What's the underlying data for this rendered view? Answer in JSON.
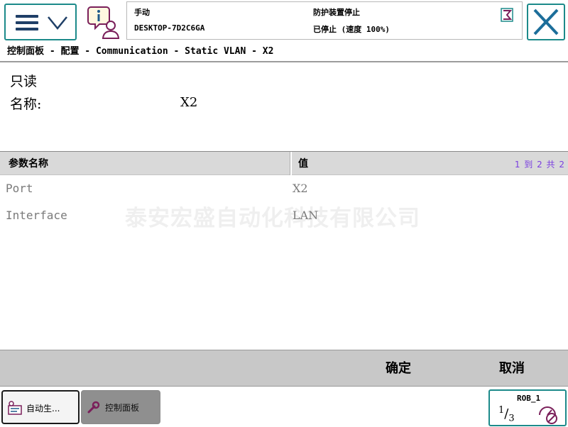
{
  "status": {
    "mode": "手动",
    "host": "DESKTOP-7D2C6GA",
    "guard": "防护装置停止",
    "speed": "已停止 (速度 100%)"
  },
  "breadcrumb": "控制面板 - 配置 - Communication - Static VLAN - X2",
  "info": {
    "readonly": "只读",
    "name_label": "名称:",
    "name_value": "X2"
  },
  "table": {
    "col_name": "参数名称",
    "col_value": "值",
    "pager": "1 到 2 共 2",
    "rows": [
      {
        "name": "Port",
        "value": "X2"
      },
      {
        "name": "Interface",
        "value": "LAN"
      }
    ]
  },
  "watermark": "泰安宏盛自动化科技有限公司",
  "actions": {
    "ok": "确定",
    "cancel": "取消"
  },
  "taskbar": {
    "tasks": [
      {
        "label": "自动生...",
        "icon": "production-window-icon"
      },
      {
        "label": "控制面板",
        "icon": "wrench-icon"
      }
    ],
    "robot": {
      "name": "ROB_1",
      "fraction_num": "1",
      "fraction_den": "3",
      "icon": "no-speed-icon"
    }
  },
  "colors": {
    "accent": "#1c8a8a",
    "header_gray": "#d9d9d9",
    "action_bar": "#c8c8c8",
    "pager": "#7a3ee0"
  }
}
